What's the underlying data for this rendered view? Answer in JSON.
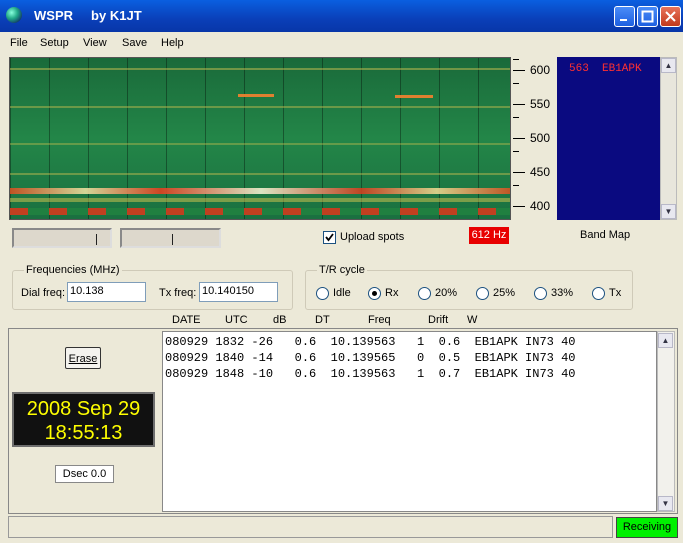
{
  "window": {
    "title": "WSPR     by K1JT"
  },
  "menu": {
    "file": "File",
    "setup": "Setup",
    "view": "View",
    "save": "Save",
    "help": "Help"
  },
  "scale": {
    "labels": [
      "600",
      "550",
      "500",
      "450",
      "400"
    ]
  },
  "band_map": {
    "label": "Band Map",
    "entries": "563  EB1APK"
  },
  "controls": {
    "upload_spots": "Upload spots",
    "upload_checked": true,
    "tx_audio_freq": "612 Hz"
  },
  "frequencies": {
    "group_label": "Frequencies (MHz)",
    "dial_label": "Dial freq:",
    "dial_value": "10.138",
    "tx_label": "Tx freq:",
    "tx_value": "10.140150"
  },
  "tr_cycle": {
    "group_label": "T/R cycle",
    "options": [
      "Idle",
      "Rx",
      "20%",
      "25%",
      "33%",
      "Tx"
    ],
    "selected": "Rx"
  },
  "decodes": {
    "headers": [
      "DATE",
      "UTC",
      "dB",
      "DT",
      "Freq",
      "Drift",
      "W"
    ],
    "lines": [
      "080929 1832 -26   0.6  10.139563   1  0.6  EB1APK IN73 40",
      "080929 1840 -14   0.6  10.139565   0  0.5  EB1APK IN73 40",
      "080929 1848 -10   0.6  10.139563   1  0.7  EB1APK IN73 40"
    ]
  },
  "left_panel": {
    "erase_label": "Erase",
    "date": "2008 Sep 29",
    "time": "18:55:13",
    "dsec": "Dsec  0.0"
  },
  "status": {
    "state": "Receiving"
  },
  "colors": {
    "accent_red": "#e80000",
    "receiving_green": "#00f000",
    "clock_yellow": "#ffff00",
    "band_map_bg": "#0a0a80"
  }
}
